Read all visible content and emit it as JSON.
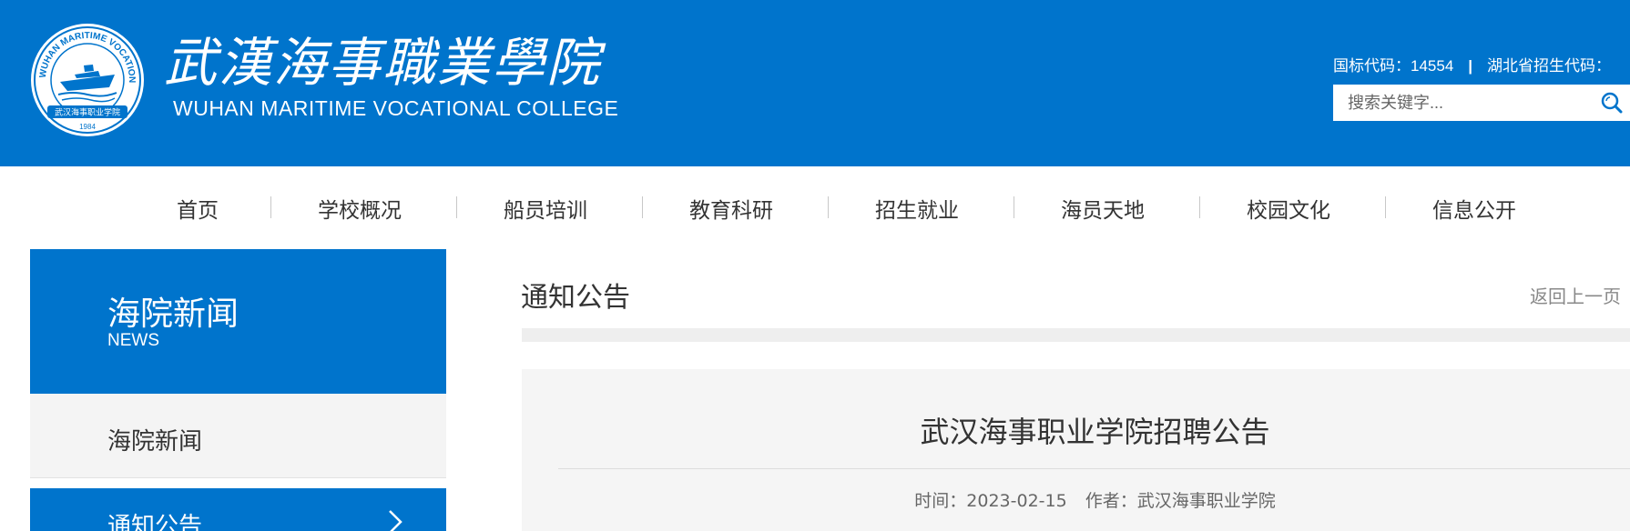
{
  "header": {
    "logo_cn": "武漢海事職業學院",
    "logo_en": "WUHAN MARITIME VOCATIONAL COLLEGE",
    "emblem": {
      "ring_text": "WUHAN MARITIME VOCATIONAL COLLEGE",
      "banner_text": "武汉海事职业学院",
      "year": "1984"
    },
    "national_code": "国标代码：14554",
    "separator": "|",
    "province_code": "湖北省招生代码：",
    "search_placeholder": "搜索关键字...",
    "brand_color": "#0074cc"
  },
  "nav": {
    "items": [
      "首页",
      "学校概况",
      "船员培训",
      "教育科研",
      "招生就业",
      "海员天地",
      "校园文化",
      "信息公开"
    ]
  },
  "sidebar": {
    "title": "海院新闻",
    "subtitle": "NEWS",
    "items": [
      {
        "label": "海院新闻",
        "active": false
      },
      {
        "label": "通知公告",
        "active": true
      }
    ]
  },
  "main": {
    "section_title": "通知公告",
    "back_link": "返回上一页",
    "article": {
      "title": "武汉海事职业学院招聘公告",
      "time": "时间：2023-02-15",
      "author": "作者：武汉海事职业学院"
    }
  }
}
